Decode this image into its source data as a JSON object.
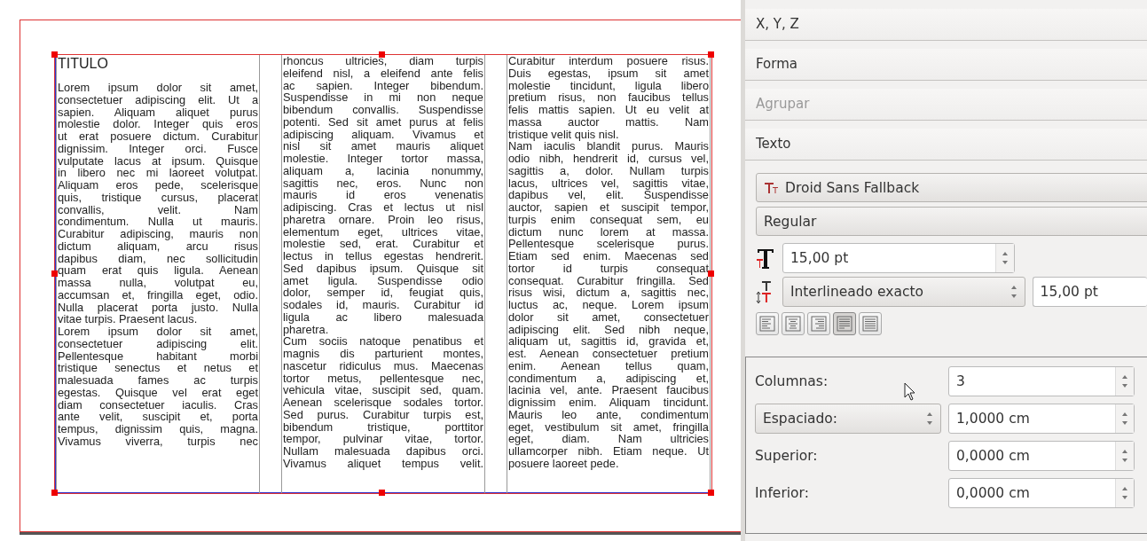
{
  "document": {
    "title": "TITULO",
    "columns": [
      {
        "paragraphs": [
          {
            "lines": [
              "Lorem ipsum dolor sit amet,",
              "consectetuer adipiscing elit. Ut a",
              "sapien. Aliquam aliquet purus",
              "molestie dolor. Integer quis eros",
              "ut erat posuere dictum. Curabitur",
              "dignissim. Integer orci. Fusce",
              "vulputate lacus at ipsum. Quisque",
              "in libero nec mi laoreet volutpat.",
              "Aliquam eros pede, scelerisque",
              "quis, tristique cursus, placerat",
              "convallis, velit. Nam",
              "condimentum. Nulla ut mauris.",
              "Curabitur adipiscing, mauris non",
              "dictum aliquam, arcu risus",
              "dapibus diam, nec sollicitudin",
              "quam erat quis ligula. Aenean",
              "massa nulla, volutpat eu,",
              "accumsan et, fringilla eget, odio.",
              "Nulla placerat porta justo. Nulla",
              "vitae turpis. Praesent lacus."
            ]
          },
          {
            "continues": true,
            "lines": [
              "Lorem ipsum dolor sit amet,",
              "consectetuer adipiscing elit.",
              "Pellentesque habitant morbi",
              "tristique senectus et netus et",
              "malesuada fames ac turpis",
              "egestas. Quisque vel erat eget",
              "diam consectetuer iaculis. Cras",
              "ante velit, suscipit et, porta",
              "tempus, dignissim quis, magna.",
              "Vivamus viverra, turpis nec"
            ]
          }
        ]
      },
      {
        "paragraphs": [
          {
            "lines": [
              "rhoncus ultricies, diam turpis",
              "eleifend nisl, a eleifend ante felis",
              "ac sapien. Integer bibendum.",
              "Suspendisse in mi non neque",
              "bibendum convallis. Suspendisse",
              "potenti. Sed sit amet purus at felis",
              "adipiscing aliquam. Vivamus et",
              "nisl sit amet mauris aliquet",
              "molestie. Integer tortor massa,",
              "aliquam a, lacinia nonummy,",
              "sagittis nec, eros. Nunc non",
              "mauris id eros venenatis",
              "adipiscing. Cras et lectus ut nisl",
              "pharetra ornare. Proin leo risus,",
              "elementum eget, ultrices vitae,",
              "molestie sed, erat. Curabitur et",
              "lectus in tellus egestas hendrerit.",
              "Sed dapibus ipsum. Quisque sit",
              "amet ligula. Suspendisse odio",
              "dolor, semper id, feugiat quis,",
              "sodales id, mauris. Curabitur id",
              "ligula ac libero malesuada",
              "pharetra."
            ]
          },
          {
            "continues": true,
            "lines": [
              "Cum sociis natoque penatibus et",
              "magnis dis parturient montes,",
              "nascetur ridiculus mus. Maecenas",
              "tortor metus, pellentesque nec,",
              "vehicula vitae, suscipit sed, quam.",
              "Aenean scelerisque sodales tortor.",
              "Sed purus. Curabitur turpis est,",
              "bibendum tristique, porttitor",
              "tempor, pulvinar vitae, tortor.",
              "Nullam malesuada dapibus orci.",
              "Vivamus aliquet tempus velit."
            ]
          }
        ]
      },
      {
        "paragraphs": [
          {
            "lines": [
              "Curabitur interdum posuere risus.",
              "Duis egestas, ipsum sit amet",
              "molestie tincidunt, ligula libero",
              "pretium risus, non faucibus tellus",
              "felis mattis sapien. Ut eu velit at",
              "massa auctor mattis. Nam",
              "tristique velit quis nisl."
            ]
          },
          {
            "lines": [
              "Nam iaculis blandit purus. Mauris",
              "odio nibh, hendrerit id, cursus vel,",
              "sagittis a, dolor. Nullam turpis",
              "lacus, ultrices vel, sagittis vitae,",
              "dapibus vel, elit. Suspendisse",
              "auctor, sapien et suscipit tempor,",
              "turpis enim consequat sem, eu",
              "dictum nunc lorem at massa.",
              "Pellentesque scelerisque purus.",
              "Etiam sed enim. Maecenas sed",
              "tortor id turpis consequat",
              "consequat. Curabitur fringilla. Sed",
              "risus wisi, dictum a, sagittis nec,",
              "luctus ac, neque. Lorem ipsum",
              "dolor sit amet, consectetuer",
              "adipiscing elit. Sed nibh neque,",
              "aliquam ut, sagittis id, gravida et,",
              "est. Aenean consectetuer pretium",
              "enim. Aenean tellus quam,",
              "condimentum a, adipiscing et,",
              "lacinia vel, ante. Praesent faucibus",
              "dignissim enim. Aliquam tincidunt.",
              "Mauris leo ante, condimentum",
              "eget, vestibulum sit amet, fringilla",
              "eget, diam. Nam ultricies",
              "ullamcorper nibh. Etiam neque. Ut",
              "posuere laoreet pede."
            ]
          }
        ]
      }
    ]
  },
  "panel": {
    "sections": [
      {
        "label": "X, Y, Z",
        "disabled": false
      },
      {
        "label": "Forma",
        "disabled": false
      },
      {
        "label": "Agrupar",
        "disabled": true
      },
      {
        "label": "Texto",
        "disabled": false
      }
    ],
    "font": "Droid Sans Fallback",
    "style": "Regular",
    "size": "15,00 pt",
    "line_spacing": {
      "mode": "Interlineado exacto",
      "value": "15,00 pt"
    },
    "alignment": [
      {
        "kind": "left",
        "selected": false
      },
      {
        "kind": "center",
        "selected": false
      },
      {
        "kind": "right",
        "selected": false
      },
      {
        "kind": "justify",
        "selected": true
      },
      {
        "kind": "forced",
        "selected": false
      }
    ],
    "column_settings": [
      {
        "kind": "label",
        "label": "Columnas:",
        "value": "3"
      },
      {
        "kind": "dropdown",
        "label": "Espaciado:",
        "value": "1,0000 cm"
      },
      {
        "kind": "label",
        "label": "Superior:",
        "value": "0,0000 cm"
      },
      {
        "kind": "label",
        "label": "Inferior:",
        "value": "0,0000 cm"
      }
    ]
  }
}
